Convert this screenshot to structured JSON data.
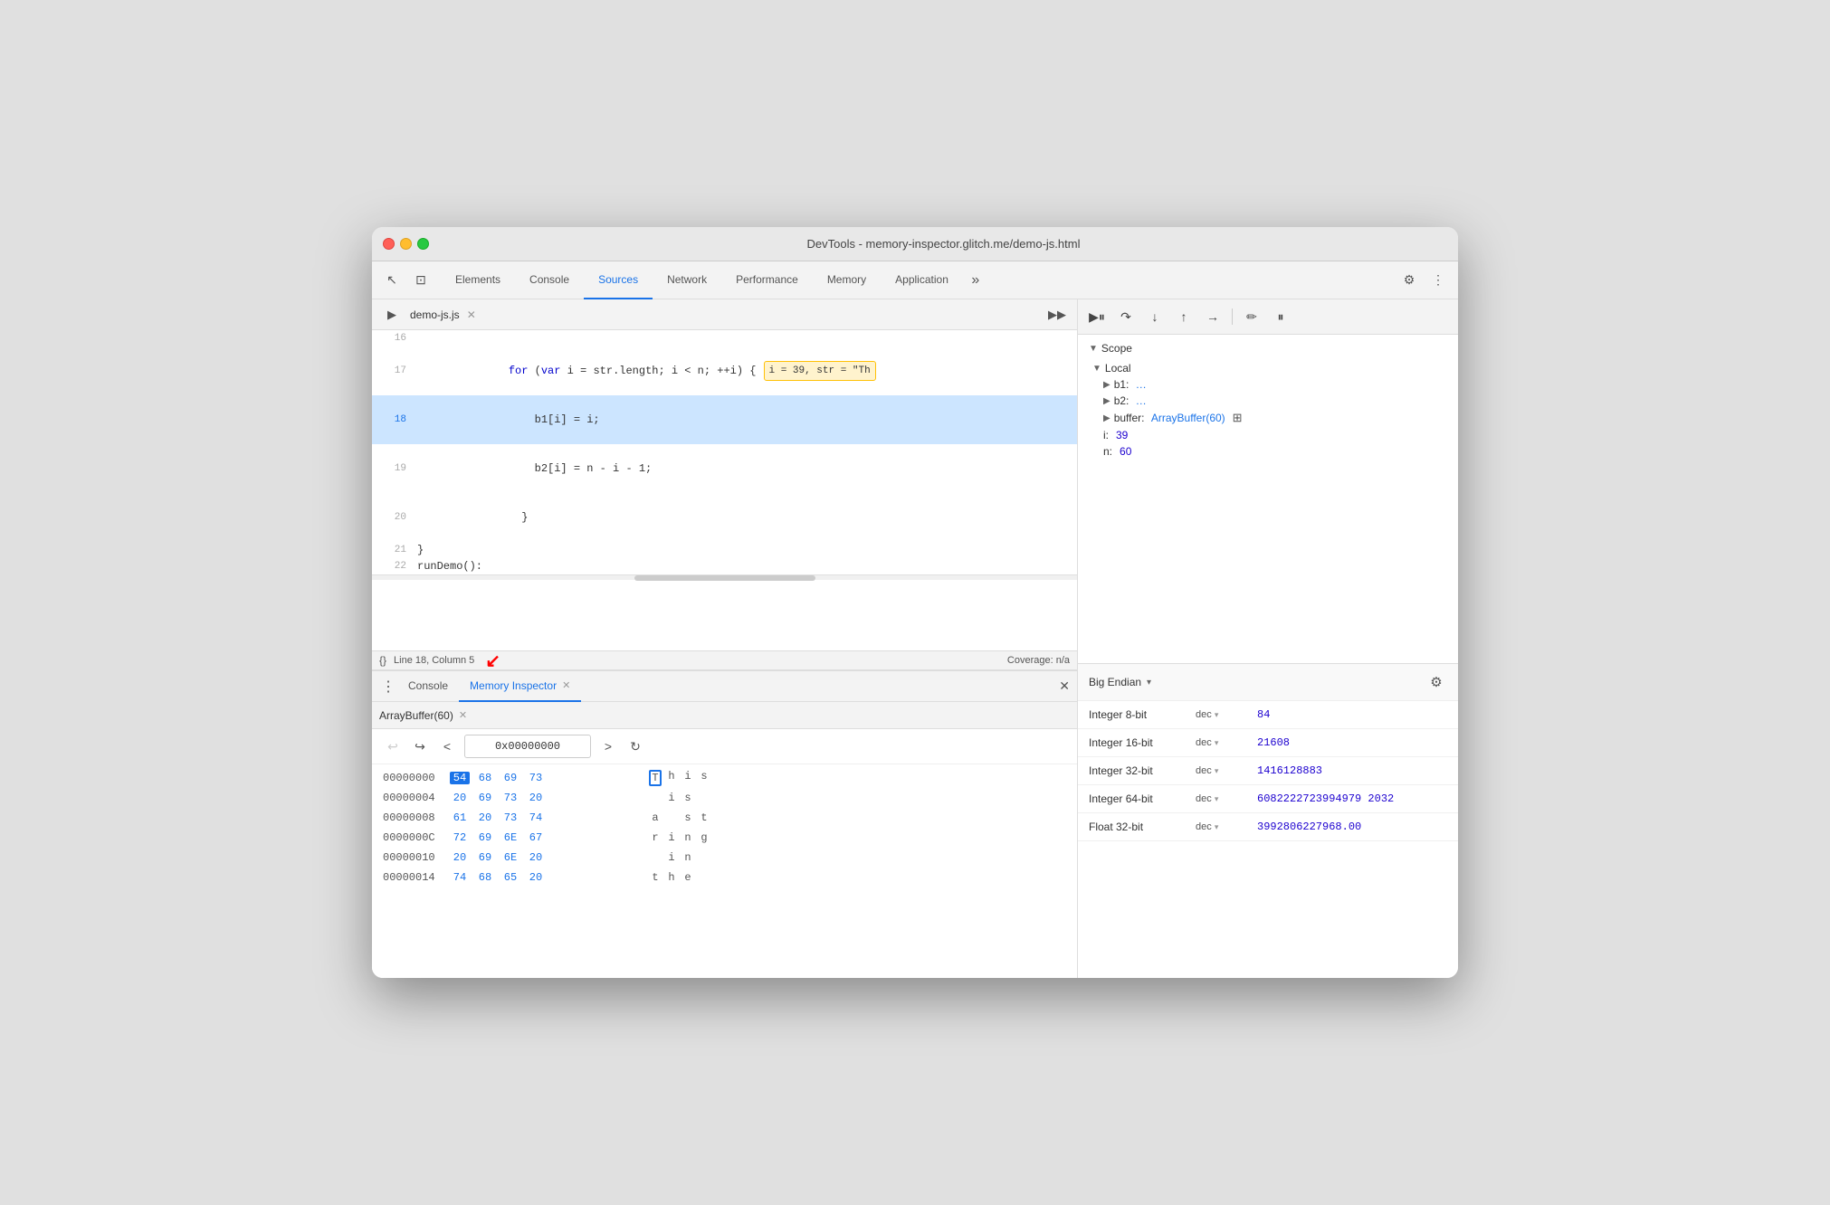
{
  "window": {
    "title": "DevTools - memory-inspector.glitch.me/demo-js.html"
  },
  "devtools": {
    "tabs": [
      {
        "label": "Elements",
        "active": false
      },
      {
        "label": "Console",
        "active": false
      },
      {
        "label": "Sources",
        "active": true
      },
      {
        "label": "Network",
        "active": false
      },
      {
        "label": "Performance",
        "active": false
      },
      {
        "label": "Memory",
        "active": false
      },
      {
        "label": "Application",
        "active": false
      }
    ]
  },
  "source": {
    "filename": "demo-js.js",
    "lines": [
      {
        "num": "16",
        "content": "",
        "active": false
      },
      {
        "num": "17",
        "content": "    for (var i = str.length; i < n; ++i) {",
        "active": false,
        "tooltip": "i = 39, str = \"Th"
      },
      {
        "num": "18",
        "content": "        b1[i] = i;",
        "active": true
      },
      {
        "num": "19",
        "content": "        b2[i] = n - i - 1;",
        "active": false
      },
      {
        "num": "20",
        "content": "    }",
        "active": false
      },
      {
        "num": "21",
        "content": "}",
        "active": false
      },
      {
        "num": "22",
        "content": "runDemo():",
        "active": false
      }
    ]
  },
  "statusBar": {
    "position": "Line 18, Column 5",
    "coverage": "Coverage: n/a",
    "format_btn": "{}"
  },
  "bottomTabs": [
    {
      "label": "Console",
      "active": false
    },
    {
      "label": "Memory Inspector",
      "active": true
    }
  ],
  "memoryInspector": {
    "subtab": "ArrayBuffer(60)",
    "address": "0x00000000",
    "rows": [
      {
        "addr": "00000000",
        "bytes": [
          "54",
          "68",
          "69",
          "73"
        ],
        "chars": [
          "T",
          "h",
          "i",
          "s"
        ],
        "selectedByte": 0,
        "boxedChar": 0
      },
      {
        "addr": "00000004",
        "bytes": [
          "20",
          "69",
          "73",
          "20"
        ],
        "chars": [
          "",
          "i",
          "s",
          ""
        ],
        "selectedByte": -1,
        "boxedChar": -1
      },
      {
        "addr": "00000008",
        "bytes": [
          "61",
          "20",
          "73",
          "74"
        ],
        "chars": [
          "a",
          "",
          "s",
          "t"
        ],
        "selectedByte": -1,
        "boxedChar": -1
      },
      {
        "addr": "0000000C",
        "bytes": [
          "72",
          "69",
          "6E",
          "67"
        ],
        "chars": [
          "r",
          "i",
          "n",
          "g"
        ],
        "selectedByte": -1,
        "boxedChar": -1
      },
      {
        "addr": "00000010",
        "bytes": [
          "20",
          "69",
          "6E",
          "20"
        ],
        "chars": [
          "",
          "i",
          "n",
          ""
        ],
        "selectedByte": -1,
        "boxedChar": -1
      },
      {
        "addr": "00000014",
        "bytes": [
          "74",
          "68",
          "65",
          "20"
        ],
        "chars": [
          "t",
          "h",
          "e",
          ""
        ],
        "selectedByte": -1,
        "boxedChar": -1
      }
    ]
  },
  "valueInspector": {
    "endian": "Big Endian",
    "rows": [
      {
        "type": "Integer 8-bit",
        "format": "dec",
        "value": "84"
      },
      {
        "type": "Integer 16-bit",
        "format": "dec",
        "value": "21608"
      },
      {
        "type": "Integer 32-bit",
        "format": "dec",
        "value": "1416128883"
      },
      {
        "type": "Integer 64-bit",
        "format": "dec",
        "value": "6082222723994979 2032"
      },
      {
        "type": "Float 32-bit",
        "format": "dec",
        "value": "3992806227968.00"
      }
    ]
  },
  "scope": {
    "header": "Scope",
    "local": "Local",
    "items": [
      {
        "key": "b1:",
        "val": "…",
        "expandable": true
      },
      {
        "key": "b2:",
        "val": "…",
        "expandable": true
      },
      {
        "key": "buffer:",
        "val": "ArrayBuffer(60)",
        "expandable": true,
        "hasIcon": true
      },
      {
        "key": "i:",
        "val": "39",
        "expandable": false
      },
      {
        "key": "n:",
        "val": "60",
        "expandable": false
      }
    ]
  }
}
